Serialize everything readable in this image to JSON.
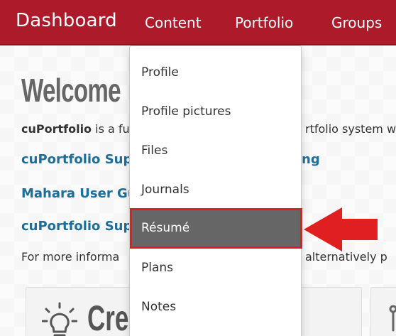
{
  "nav": {
    "brand": "Dashboard",
    "items": [
      {
        "label": "Content"
      },
      {
        "label": "Portfolio"
      },
      {
        "label": "Groups"
      }
    ]
  },
  "main": {
    "title": "Welcome",
    "intro_bold": "cuPortfolio",
    "intro_rest": " is a fu",
    "intro_right": "rtfolio system w",
    "links": [
      {
        "label": "cuPortfolio Sup",
        "tail": "ng"
      },
      {
        "label": "Mahara User Gu"
      },
      {
        "label": "cuPortfolio Sup"
      }
    ],
    "more_left": "For more informa",
    "more_right": "alternatively p",
    "create_card": {
      "title": "Create",
      "icon": "lightbulb-icon"
    }
  },
  "dropdown": {
    "items": [
      {
        "label": "Profile"
      },
      {
        "label": "Profile pictures"
      },
      {
        "label": "Files"
      },
      {
        "label": "Journals"
      },
      {
        "label": "Résumé",
        "selected": true
      },
      {
        "label": "Plans"
      },
      {
        "label": "Notes"
      }
    ]
  },
  "annotation": {
    "icon": "red-arrow-icon",
    "color": "#e02020"
  },
  "colors": {
    "brand": "#ad1b2a",
    "link": "#1e6e9a",
    "selected_bg": "#666666",
    "highlight": "#e02020"
  }
}
